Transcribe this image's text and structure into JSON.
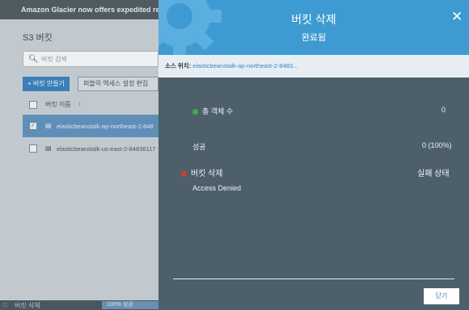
{
  "background": {
    "banner": "Amazon Glacier now offers expedited re",
    "title": "S3 버킷",
    "search_placeholder": "버킷 검색",
    "create_button": "+ 버킷 만들기",
    "public_button": "퍼블릭 액세스 설정 편집",
    "column_name": "버킷 이름",
    "rows": [
      {
        "name": "elasticbeanstalk-ap-northeast-2-848",
        "selected": true
      },
      {
        "name": "elasticbeanstalk-us-east-2-84836117",
        "selected": false
      }
    ],
    "status_bar": {
      "label": "버킷 삭제",
      "progress": "100% 성공"
    }
  },
  "modal": {
    "title": "버킷 삭제",
    "subtitle": "완료됨",
    "source_label": "소스 위치:",
    "source_value": "elasticbeanstalk-ap-northeast-2-8483...",
    "total_objects_label": "총 객체 수",
    "total_objects_value": "0",
    "success_label": "성공",
    "success_value": "0 (100%)",
    "delete_label": "버킷 삭제",
    "delete_status": "실패 상태",
    "error_message": "Access Denied",
    "close_button": "닫기"
  },
  "colors": {
    "header_blue": "#3d9bd2",
    "panel": "#4d5f6a",
    "success_green": "#3fae49",
    "failure_red": "#d93a2e"
  }
}
